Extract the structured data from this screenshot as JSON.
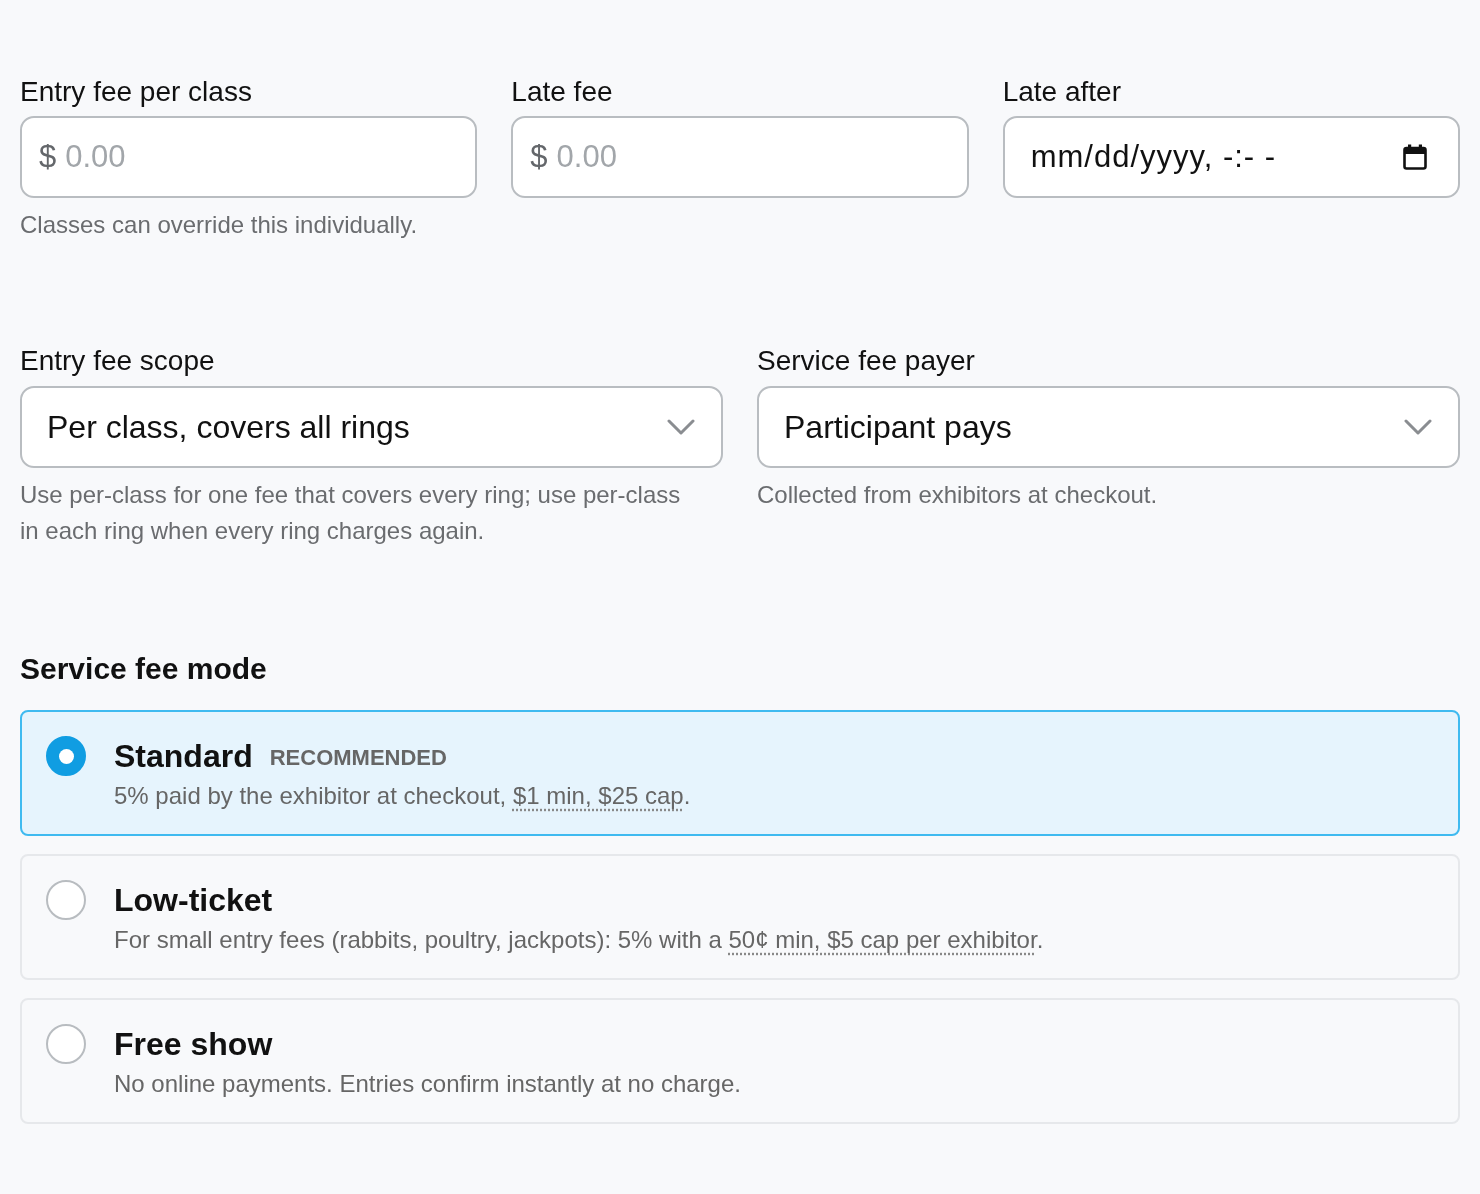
{
  "fee_fields": [
    {
      "kind": "money",
      "label": "Entry fee per class",
      "prefix": "$",
      "placeholder": "0.00",
      "help": "Classes can override this individually."
    },
    {
      "kind": "money",
      "label": "Late fee",
      "prefix": "$",
      "placeholder": "0.00"
    },
    {
      "kind": "datetime",
      "label": "Late after",
      "value": "mm/dd/yyyy, -:- -"
    }
  ],
  "selects": [
    {
      "label": "Entry fee scope",
      "value": "Per class, covers all rings",
      "help": "Use per-class for one fee that covers every ring; use per-class in each ring when every ring charges again."
    },
    {
      "label": "Service fee payer",
      "value": "Participant pays",
      "help": "Collected from exhibitors at checkout."
    }
  ],
  "service_fee_mode": {
    "title": "Service fee mode",
    "options": [
      {
        "title": "Standard",
        "badge": "RECOMMENDED",
        "selected": true,
        "description": [
          {
            "kind": "plain",
            "text": "5% paid by the exhibitor at checkout, "
          },
          {
            "kind": "term",
            "text": "$1 min, $25 cap"
          },
          {
            "kind": "plain",
            "text": "."
          }
        ]
      },
      {
        "title": "Low-ticket",
        "selected": false,
        "description": [
          {
            "kind": "plain",
            "text": "For small entry fees (rabbits, poultry, jackpots): 5% with a "
          },
          {
            "kind": "term",
            "text": "50¢ min, $5 cap per exhibitor"
          },
          {
            "kind": "plain",
            "text": "."
          }
        ]
      },
      {
        "title": "Free show",
        "selected": false,
        "description": [
          {
            "kind": "plain",
            "text": "No online payments. Entries confirm instantly at no charge."
          }
        ]
      }
    ]
  }
}
